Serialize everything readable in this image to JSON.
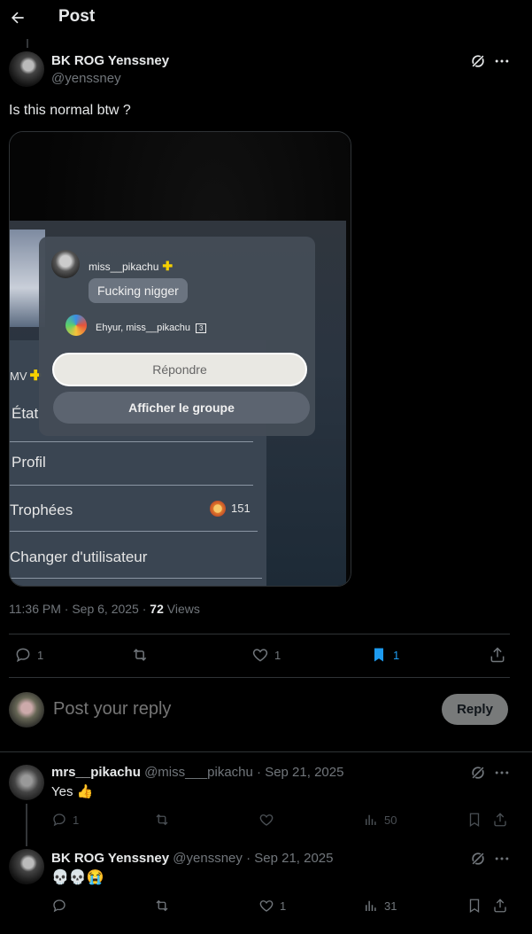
{
  "header": {
    "title": "Post"
  },
  "post": {
    "author_name": "BK ROG Yenssney",
    "author_handle": "@yenssney",
    "text": "Is this normal btw ?",
    "timestamp": "11:36 PM · Sep 6, 2025 ·",
    "views_count": "72",
    "views_label": "Views",
    "replies": "1",
    "likes": "1",
    "bookmarks": "1"
  },
  "media": {
    "popup_user": "miss__pikachu",
    "message": "Fucking nigger",
    "group_text": "Ehyur, miss__pikachu",
    "group_count": "3",
    "reply_button": "Répondre",
    "group_button": "Afficher le groupe",
    "side_label": "MV",
    "menu_state": "État",
    "menu_profile": "Profil",
    "menu_trophies": "Trophées",
    "trophy_count": "151",
    "menu_switch": "Changer d'utilisateur"
  },
  "composer": {
    "placeholder": "Post your reply",
    "button": "Reply"
  },
  "replies": [
    {
      "name": "mrs__pikachu",
      "handle": "@miss___pikachu",
      "date": "· Sep 21, 2025",
      "text": "Yes 👍",
      "replies": "1",
      "likes": "",
      "views": "50"
    },
    {
      "name": "BK ROG Yenssney",
      "handle": "@yenssney",
      "date": "· Sep 21, 2025",
      "text": "💀💀😭",
      "replies": "",
      "likes": "1",
      "views": "31"
    }
  ],
  "colors": {
    "accent": "#1d9bf0",
    "muted": "#71767b",
    "divider": "#2f3336",
    "ps_plus": "#f5d000"
  }
}
